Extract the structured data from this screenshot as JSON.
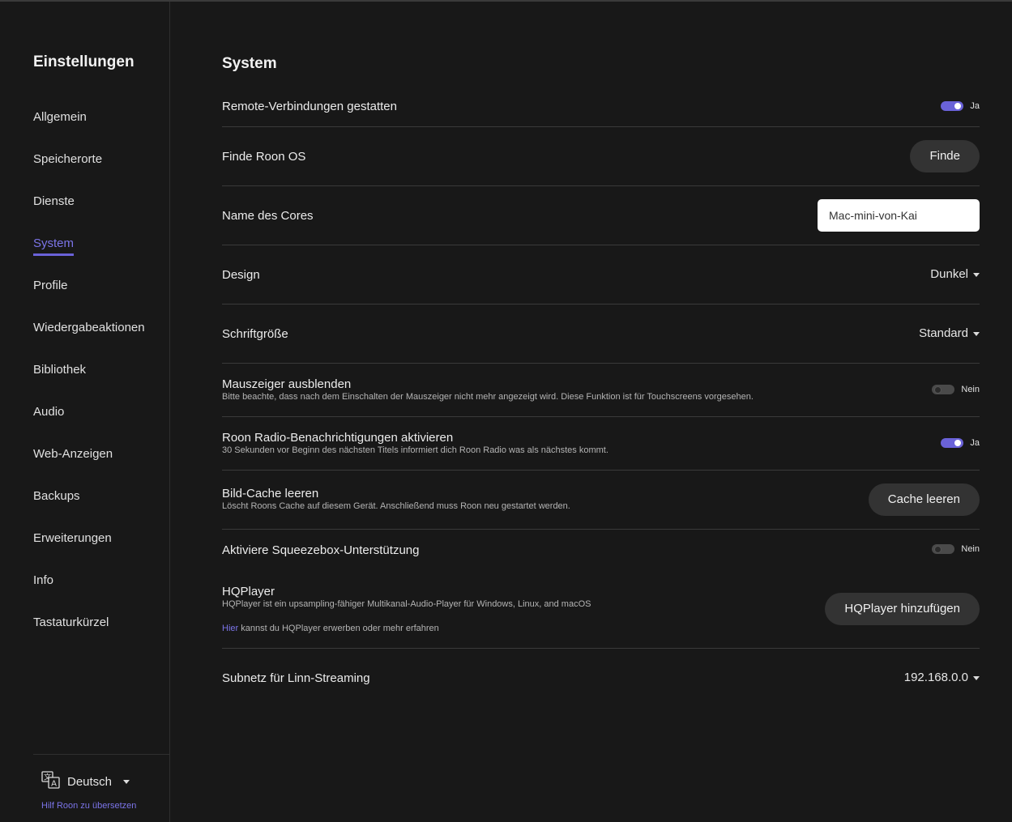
{
  "sidebar": {
    "title": "Einstellungen",
    "items": [
      {
        "label": "Allgemein",
        "active": false
      },
      {
        "label": "Speicherorte",
        "active": false
      },
      {
        "label": "Dienste",
        "active": false
      },
      {
        "label": "System",
        "active": true
      },
      {
        "label": "Profile",
        "active": false
      },
      {
        "label": "Wiedergabeaktionen",
        "active": false
      },
      {
        "label": "Bibliothek",
        "active": false
      },
      {
        "label": "Audio",
        "active": false
      },
      {
        "label": "Web-Anzeigen",
        "active": false
      },
      {
        "label": "Backups",
        "active": false
      },
      {
        "label": "Erweiterungen",
        "active": false
      },
      {
        "label": "Info",
        "active": false
      },
      {
        "label": "Tastaturkürzel",
        "active": false
      }
    ],
    "language": {
      "value": "Deutsch",
      "icon": "translate-icon"
    },
    "help_link": "Hilf Roon zu übersetzen"
  },
  "main": {
    "title": "System",
    "remote": {
      "label": "Remote-Verbindungen gestatten",
      "state": "Ja"
    },
    "find_roon_os": {
      "label": "Finde Roon OS",
      "button": "Finde"
    },
    "core_name": {
      "label": "Name des Cores",
      "value": "Mac-mini-von-Kai"
    },
    "design": {
      "label": "Design",
      "value": "Dunkel"
    },
    "font_size": {
      "label": "Schriftgröße",
      "value": "Standard"
    },
    "hide_cursor": {
      "label": "Mauszeiger ausblenden",
      "desc": "Bitte beachte, dass nach dem Einschalten der Mauszeiger nicht mehr angezeigt wird. Diese Funktion ist für Touchscreens vorgesehen.",
      "state": "Nein"
    },
    "radio_notifications": {
      "label": "Roon Radio-Benachrichtigungen aktivieren",
      "desc": "30 Sekunden vor Beginn des nächsten Titels informiert dich Roon Radio was als nächstes kommt.",
      "state": "Ja"
    },
    "image_cache": {
      "label": "Bild-Cache leeren",
      "desc": "Löscht Roons Cache auf diesem Gerät. Anschließend muss Roon neu gestartet werden.",
      "button": "Cache leeren"
    },
    "squeezebox": {
      "label": "Aktiviere Squeezebox-Unterstützung",
      "state": "Nein"
    },
    "hqplayer": {
      "label": "HQPlayer",
      "desc": "HQPlayer ist ein upsampling-fähiger Multikanal-Audio-Player für Windows, Linux, and macOS",
      "link": "Hier",
      "link_suffix": " kannst du HQPlayer erwerben oder mehr erfahren",
      "button": "HQPlayer hinzufügen"
    },
    "linn_subnet": {
      "label": "Subnetz für Linn-Streaming",
      "value": "192.168.0.0"
    }
  },
  "colors": {
    "background": "#181818",
    "accent": "#6a62d8",
    "link": "#7b74e8",
    "button_bg": "#333333"
  }
}
